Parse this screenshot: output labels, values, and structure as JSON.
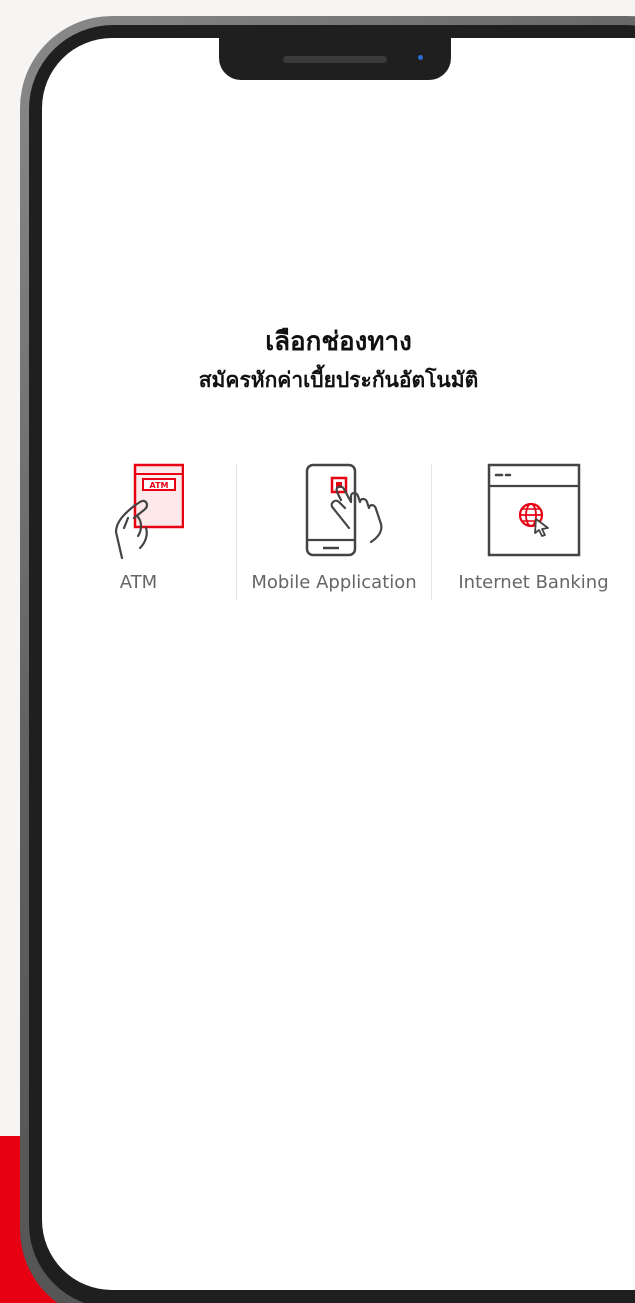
{
  "screen": {
    "title": "เลือกช่องทาง",
    "subtitle": "สมัครหักค่าเบี้ยประกันอัตโนมัติ"
  },
  "options": [
    {
      "label": "ATM",
      "icon": "atm-card-hand-icon"
    },
    {
      "label": "Mobile Application",
      "icon": "mobile-tap-icon"
    },
    {
      "label": "Internet Banking",
      "icon": "browser-globe-icon"
    }
  ],
  "colors": {
    "accent": "#e60012",
    "text": "#111111",
    "label": "#666666",
    "background": "#f6f5f3",
    "frame": "#1f1f1f"
  }
}
